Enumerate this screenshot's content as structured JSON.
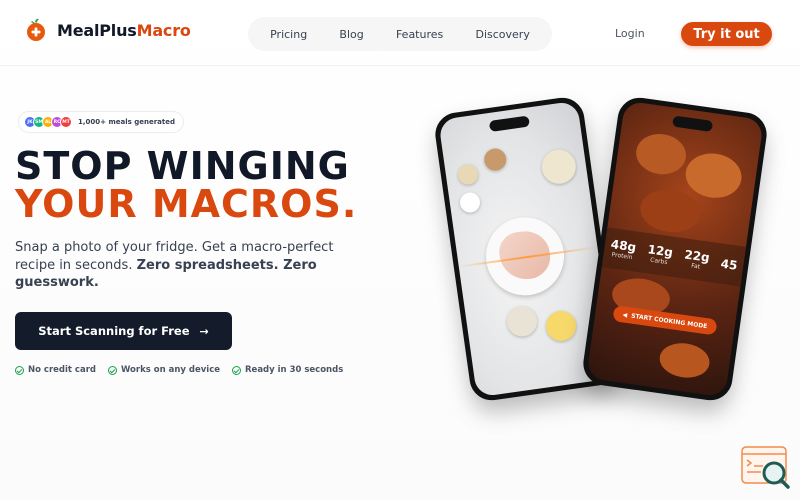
{
  "brand": {
    "name_part1": "MealPlus",
    "name_part2": "Macro",
    "accent_color": "#d9480f"
  },
  "nav": {
    "items": [
      "Pricing",
      "Blog",
      "Features",
      "Discovery"
    ]
  },
  "header": {
    "login_label": "Login",
    "try_label": "Try it out"
  },
  "hero": {
    "avatars": [
      "JK",
      "SM",
      "AL",
      "RC",
      "MT"
    ],
    "meals_badge": "1,000+ meals generated",
    "headline_line1": "STOP WINGING",
    "headline_line2": "YOUR MACROS.",
    "subtitle_plain": "Snap a photo of your fridge. Get a macro-perfect recipe in seconds. ",
    "subtitle_bold": "Zero spreadsheets. Zero guesswork.",
    "cta_label": "Start Scanning for Free",
    "cta_icon": "arrow-right-icon",
    "features": [
      "No credit card",
      "Works on any device",
      "Ready in 30 seconds"
    ]
  },
  "phone_right": {
    "macros": [
      {
        "value": "48g",
        "label": "Protein"
      },
      {
        "value": "12g",
        "label": "Carbs"
      },
      {
        "value": "22g",
        "label": "Fat"
      },
      {
        "value": "45",
        "label": ""
      }
    ],
    "cook_label": "START COOKING MODE"
  }
}
